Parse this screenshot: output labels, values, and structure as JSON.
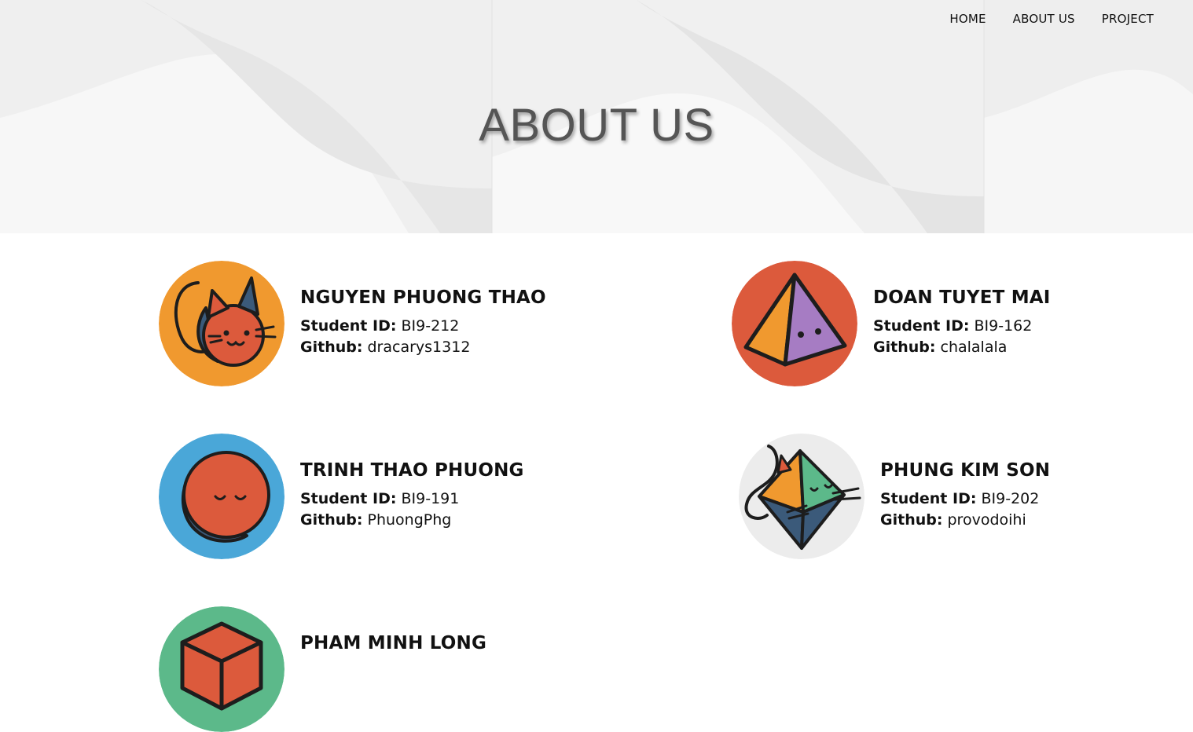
{
  "nav": {
    "items": [
      {
        "label": "HOME"
      },
      {
        "label": "ABOUT US"
      },
      {
        "label": "PROJECT"
      }
    ]
  },
  "hero": {
    "title": "ABOUT US"
  },
  "labels": {
    "student_id": "Student ID:",
    "github": "Github:"
  },
  "members": [
    {
      "name": "NGUYEN PHUONG THAO",
      "student_id": "BI9-212",
      "github": "dracarys1312",
      "avatar": "cat-avatar-icon",
      "avatar_color": "#f0992f"
    },
    {
      "name": "DOAN TUYET MAI",
      "student_id": "BI9-162",
      "github": "chalalala",
      "avatar": "pyramid-avatar-icon",
      "avatar_color": "#dc5a3c"
    },
    {
      "name": "TRINH THAO PHUONG",
      "student_id": "BI9-191",
      "github": "PhuongPhg",
      "avatar": "moon-avatar-icon",
      "avatar_color": "#4aa7d8"
    },
    {
      "name": "PHUNG KIM SON",
      "student_id": "BI9-202",
      "github": "provodoihi",
      "avatar": "diamond-cat-avatar-icon",
      "avatar_color": "#ececec"
    },
    {
      "name": "PHAM MINH LONG",
      "avatar": "cube-avatar-icon",
      "avatar_color": "#5cb98a"
    }
  ]
}
